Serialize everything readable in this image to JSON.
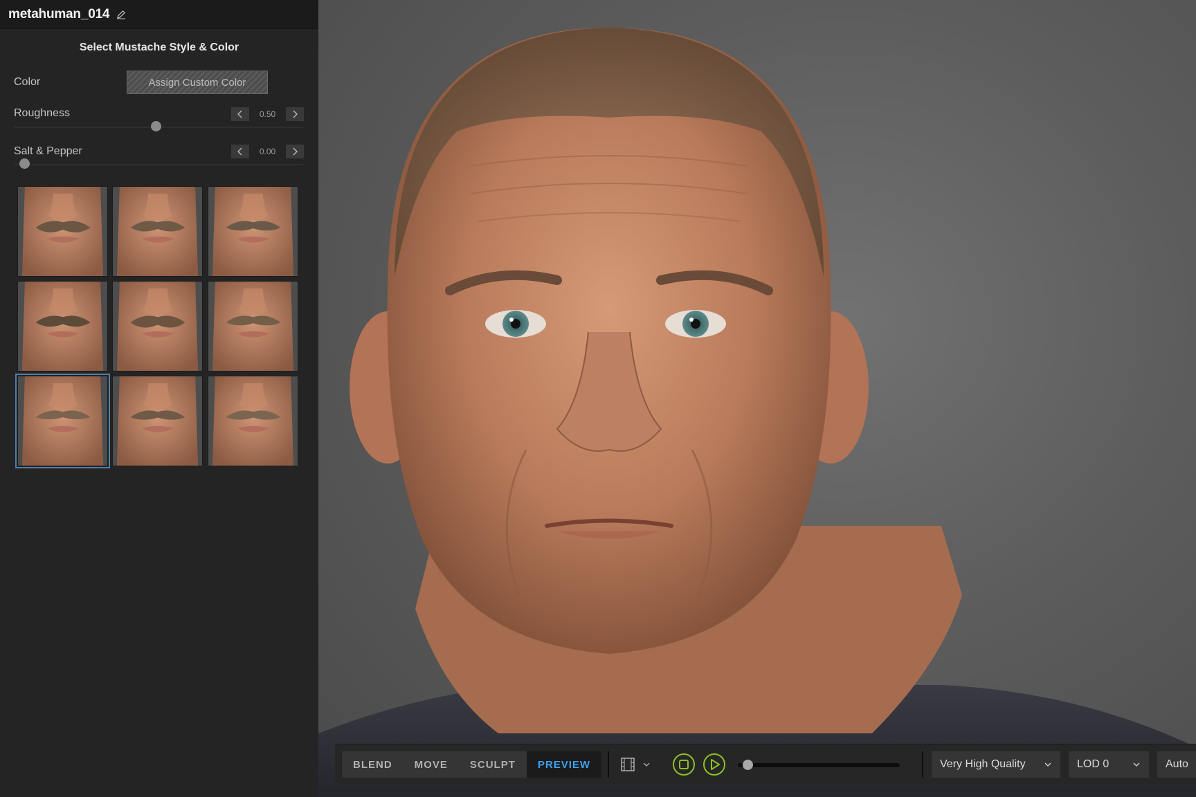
{
  "app": {
    "title": "metahuman_014"
  },
  "panel": {
    "section_title": "Select Mustache Style & Color",
    "color": {
      "label": "Color",
      "button_label": "Assign Custom Color"
    },
    "roughness": {
      "label": "Roughness",
      "value": "0.50",
      "fraction": 0.5
    },
    "salt_pepper": {
      "label": "Salt & Pepper",
      "value": "0.00",
      "fraction": 0.0
    },
    "styles": {
      "count": 9,
      "selected_index": 6,
      "icons": [
        "mustache-thumbnail"
      ]
    }
  },
  "toolbar": {
    "modes": [
      {
        "label": "BLEND",
        "active": false
      },
      {
        "label": "MOVE",
        "active": false
      },
      {
        "label": "SCULPT",
        "active": false
      },
      {
        "label": "PREVIEW",
        "active": true
      }
    ],
    "timeline_fraction": 0.0,
    "quality": "Very High Quality",
    "lod": "LOD 0",
    "auto": "Auto",
    "accent_color": "#3ea1ee",
    "playback_color": "#8fc026"
  }
}
